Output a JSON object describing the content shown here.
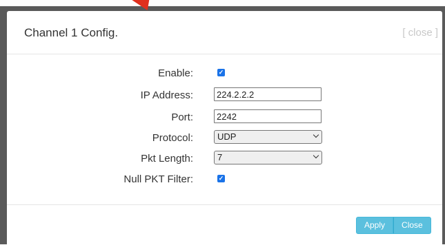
{
  "modal": {
    "title": "Channel 1 Config.",
    "close_link": "[ close ]"
  },
  "form": {
    "enable": {
      "label": "Enable:",
      "checked": true
    },
    "ip_address": {
      "label": "IP Address:",
      "value": "224.2.2.2"
    },
    "port": {
      "label": "Port:",
      "value": "2242"
    },
    "protocol": {
      "label": "Protocol:",
      "selected": "UDP"
    },
    "pkt_length": {
      "label": "Pkt Length:",
      "selected": "7"
    },
    "null_pkt_filter": {
      "label": "Null PKT Filter:",
      "checked": true
    }
  },
  "footer": {
    "apply_label": "Apply",
    "close_label": "Close"
  },
  "colors": {
    "accent": "#5bc0de",
    "checkbox": "#1a73e8",
    "arrow": "#e0301e"
  }
}
